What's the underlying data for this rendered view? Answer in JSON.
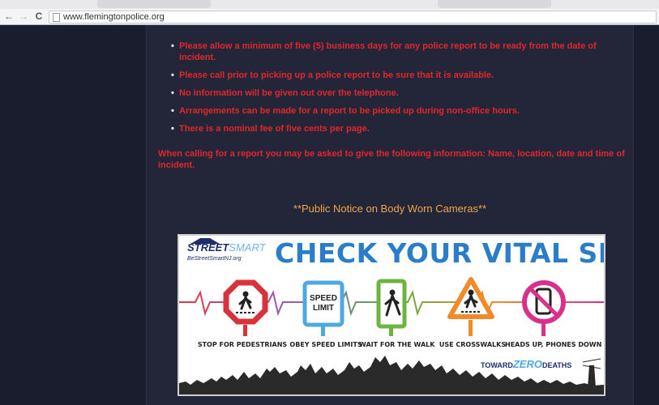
{
  "browser": {
    "url": "www.flemingtonpolice.org"
  },
  "rules": [
    "Please allow a minimum of five (5) business days for any police report to be ready from the date of incident.",
    "Please call prior to picking up a police report to be sure that it is available.",
    "No information will be given out over the telephone.",
    "Arrangements can be made for a report to be picked up during non-office hours.",
    "There is a nominal fee of five cents per page."
  ],
  "info_text": "When calling for a report you may be asked to give the following information: Name, location, date and time of incident.",
  "notice": "**Public Notice on Body Worn Cameras**",
  "banner": {
    "brand_street": "STREET",
    "brand_smart": "SMART",
    "brand_site": "BeStreetSmartNJ.org",
    "headline": "CHECK YOUR VITAL SIGNS",
    "speed_sign_1": "SPEED",
    "speed_sign_2": "LIMIT",
    "captions": [
      "STOP FOR PEDESTRIANS",
      "OBEY SPEED LIMITS",
      "WAIT FOR THE WALK",
      "USE CROSSWALKS",
      "HEADS UP, PHONES DOWN"
    ],
    "zero_pre": "TOWARD",
    "zero_word": "ZERO",
    "zero_post": "DEATHS"
  },
  "colors": {
    "page_bg": "#1a1d2e",
    "content_bg": "#232638",
    "rule_red": "#e2262b",
    "notice_orange": "#f0a44a",
    "headline_blue": "#2c7dc8"
  }
}
